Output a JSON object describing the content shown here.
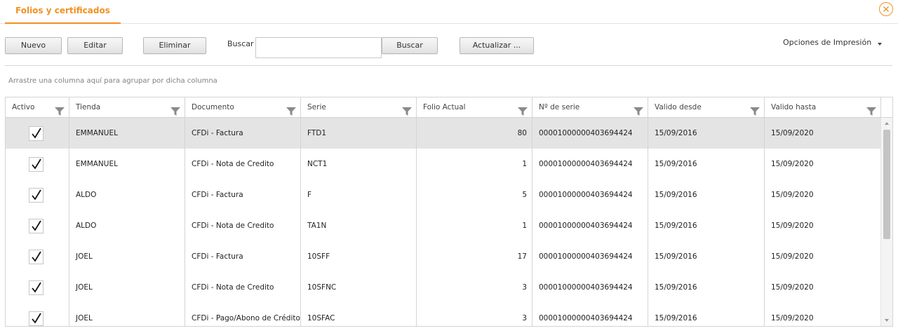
{
  "tab": {
    "title": "Folios y certificados"
  },
  "toolbar": {
    "new_label": "Nuevo",
    "edit_label": "Editar",
    "delete_label": "Eliminar",
    "search_label": "Buscar :",
    "search_value": "",
    "search_button_label": "Buscar",
    "refresh_label": "Actualizar ...",
    "print_options_label": "Opciones de Impresión"
  },
  "grid": {
    "group_hint": "Arrastre una columna aquí para agrupar por dicha columna",
    "columns": [
      "Activo",
      "Tienda",
      "Documento",
      "Serie",
      "Folio Actual",
      "Nº de serie",
      "Valido desde",
      "Valido hasta"
    ],
    "rows": [
      {
        "activo": true,
        "tienda": "EMMANUEL",
        "documento": "CFDi - Factura",
        "serie": "FTD1",
        "folio": "80",
        "nserie": "00001000000403694424",
        "desde": "15/09/2016",
        "hasta": "15/09/2020",
        "selected": true
      },
      {
        "activo": true,
        "tienda": "EMMANUEL",
        "documento": "CFDi - Nota de Credito",
        "serie": "NCT1",
        "folio": "1",
        "nserie": "00001000000403694424",
        "desde": "15/09/2016",
        "hasta": "15/09/2020"
      },
      {
        "activo": true,
        "tienda": "ALDO",
        "documento": "CFDi - Factura",
        "serie": "F",
        "folio": "5",
        "nserie": "00001000000403694424",
        "desde": "15/09/2016",
        "hasta": "15/09/2020"
      },
      {
        "activo": true,
        "tienda": "ALDO",
        "documento": "CFDi - Nota de Credito",
        "serie": "TA1N",
        "folio": "1",
        "nserie": "00001000000403694424",
        "desde": "15/09/2016",
        "hasta": "15/09/2020"
      },
      {
        "activo": true,
        "tienda": "JOEL",
        "documento": "CFDi - Factura",
        "serie": "10SFF",
        "folio": "17",
        "nserie": "00001000000403694424",
        "desde": "15/09/2016",
        "hasta": "15/09/2020"
      },
      {
        "activo": true,
        "tienda": "JOEL",
        "documento": "CFDi - Nota de Credito",
        "serie": "10SFNC",
        "folio": "3",
        "nserie": "00001000000403694424",
        "desde": "15/09/2016",
        "hasta": "15/09/2020"
      },
      {
        "activo": true,
        "tienda": "JOEL",
        "documento": "CFDi - Pago/Abono de Crédito",
        "serie": "10SFAC",
        "folio": "3",
        "nserie": "00001000000403694424",
        "desde": "15/09/2016",
        "hasta": "15/09/2020"
      }
    ]
  },
  "colors": {
    "accent": "#f29123",
    "selected_row": "#e4e4e4",
    "border": "#d4d4d4"
  },
  "icons": {
    "close": "close-icon",
    "filter": "filter-icon",
    "check": "check-icon",
    "dropdown": "chevron-down-icon"
  }
}
